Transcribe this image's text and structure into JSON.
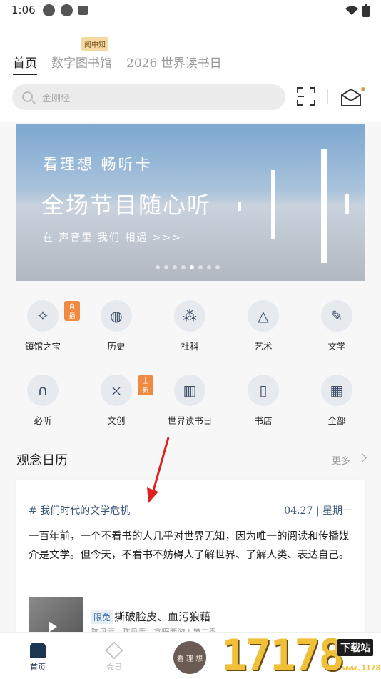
{
  "status": {
    "time": "1:06"
  },
  "tabs": [
    {
      "label": "首页"
    },
    {
      "label": "数字图书馆"
    },
    {
      "label": "2026 世界读书日"
    }
  ],
  "tab_badge": "阅中知",
  "search": {
    "placeholder": "金刚经"
  },
  "banner": {
    "line1": "看理想 畅听卡",
    "line2": "全场节目随心听",
    "line3": "在 声音里 我们 相遇 >>>",
    "page_count": 8,
    "active_page": 5
  },
  "categories": [
    {
      "label": "镇馆之宝",
      "icon": "treasure-icon",
      "badge": "直播"
    },
    {
      "label": "历史",
      "icon": "globe-icon"
    },
    {
      "label": "社科",
      "icon": "social-icon"
    },
    {
      "label": "艺术",
      "icon": "shapes-icon"
    },
    {
      "label": "文学",
      "icon": "ink-icon"
    },
    {
      "label": "必听",
      "icon": "headphones-icon"
    },
    {
      "label": "文创",
      "icon": "hourglass-icon",
      "badge": "上新"
    },
    {
      "label": "世界读书日",
      "icon": "bookday-icon"
    },
    {
      "label": "书店",
      "icon": "bookstore-icon"
    },
    {
      "label": "全部",
      "icon": "grid-icon"
    }
  ],
  "section": {
    "title": "观念日历",
    "more": "更多"
  },
  "card": {
    "tag": "# 我们时代的文学危机",
    "date": "04.27 | 星期一",
    "text": "一百年前，一个不看书的人几乎对世界无知，因为唯一的阅读和传播媒介是文学。但今天，不看书不妨碍人了解世界、了解人类、表达自己。",
    "limit_label": "限免",
    "sub_title": "撕破脸皮、血污狼藉",
    "sub_meta": "陈丹青 · 陈丹青：富野西游 | 第二季"
  },
  "bottom_nav": [
    {
      "label": "首页"
    },
    {
      "label": "会员"
    },
    {
      "label": "看 理 想"
    }
  ],
  "watermark": {
    "big": "17178",
    "small": "下载站",
    "url": "www.1178.com"
  }
}
